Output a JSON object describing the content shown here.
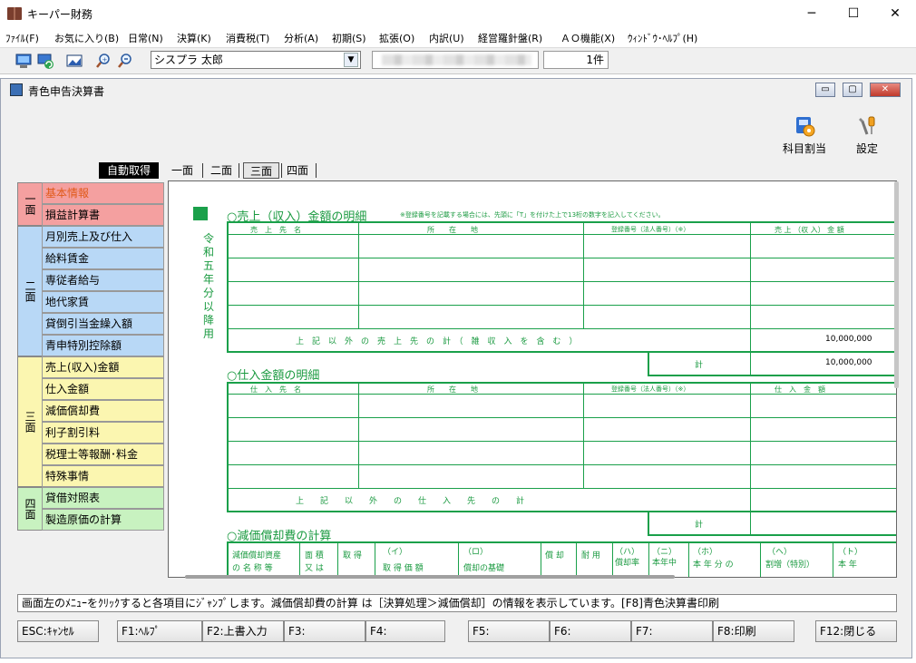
{
  "window": {
    "title": "キーパー財務",
    "minimize": "─",
    "maximize": "☐",
    "close": "✕"
  },
  "menu": [
    "ﾌｧｲﾙ(F)",
    "お気に入り(B)",
    "日常(N)",
    "決算(K)",
    "消費税(T)",
    "分析(A)",
    "初期(S)",
    "拡張(O)",
    "内訳(U)",
    "経営羅針盤(R)",
    "ＡＯ機能(X)",
    "ｳｨﾝﾄﾞｳ･ﾍﾙﾌﾟ(H)"
  ],
  "toolbar": {
    "user": "シスプラ 太郎",
    "count": "1件"
  },
  "inner": {
    "title": "青色申告決算書",
    "btn_min": "▭",
    "btn_max": "▢",
    "btn_close": "✕"
  },
  "actions": {
    "assign": "科目割当",
    "settings": "設定"
  },
  "tabs": {
    "auto": "自動取得",
    "t1": "一面",
    "t2": "二面",
    "t3": "三面",
    "t4": "四面"
  },
  "nav": {
    "sec1": "一面",
    "sec2": "二面",
    "sec3": "三面",
    "sec4": "四面",
    "items": [
      "基本情報",
      "損益計算書",
      "月別売上及び仕入",
      "給料賃金",
      "専従者給与",
      "地代家賃",
      "貸倒引当金繰入額",
      "青申特別控除額",
      "売上(収入)金額",
      "仕入金額",
      "減価償却費",
      "利子割引料",
      "税理士等報酬･料金",
      "特殊事情",
      "貸借対照表",
      "製造原価の計算"
    ]
  },
  "form": {
    "side_label": "令和五年分以降用",
    "sales": {
      "title": "○売上（収入）金額の明細",
      "note": "※登録番号を記載する場合には、先頭に「T」を付けた上で13桁の数字を記入してください。",
      "h1": "売　上　先　名",
      "h2": "所　　在　　地",
      "h3": "登録番号（法人番号）（※）",
      "h4": "売 上 （収 入） 金 額",
      "other": "上　記　以　外　の　売　上　先　の　計　（　雑　収　入　を　含　む　）",
      "other_value": "10,000,000",
      "total_label": "計",
      "total_value": "10,000,000"
    },
    "purchase": {
      "title": "○仕入金額の明細",
      "h1": "仕　入　先　名",
      "h2": "所　　在　　地",
      "h3": "登録番号（法人番号）（※）",
      "h4": "仕　入　金　額",
      "other": "上　　記　　以　　外　　の　　仕　　入　　先　　の　　計",
      "total_label": "計"
    },
    "dep": {
      "title": "○減価償却費の計算",
      "c1a": "減価償却資産",
      "c1b": "の 名 称 等",
      "c2a": "面 積",
      "c2b": "又 は",
      "c3": "取 得",
      "c4a": "（イ）",
      "c4b": "取 得 価 額",
      "c5a": "（ロ）",
      "c5b": "償却の基礎",
      "c6": "償 却",
      "c7": "耐 用",
      "c8a": "（ハ）",
      "c8b": "償却率",
      "c9a": "（ニ）",
      "c9b": "本年中",
      "c10a": "（ホ）",
      "c10b": "本 年 分 の",
      "c11a": "（ヘ）",
      "c11b": "割増（特別）",
      "c12a": "（ト）",
      "c12b": "本 年"
    }
  },
  "status": "画面左のﾒﾆｭｰをｸﾘｯｸすると各項目にｼﾞｬﾝﾌﾟします。減価償却費の計算 は［決算処理＞減価償却］の情報を表示しています。[F8]青色決算書印刷",
  "fkeys": [
    "ESC:ｷｬﾝｾﾙ",
    "F1:ﾍﾙﾌﾟ",
    "F2:上書入力",
    "F3:",
    "F4:",
    "F5:",
    "F6:",
    "F7:",
    "F8:印刷",
    "F12:閉じる"
  ],
  "colors": {
    "green": "#1aa04a",
    "red_section": "#f4a0a0",
    "blue_section": "#b8d8f6",
    "yellow_section": "#fbf6b0",
    "green_section": "#c8f2c0"
  }
}
